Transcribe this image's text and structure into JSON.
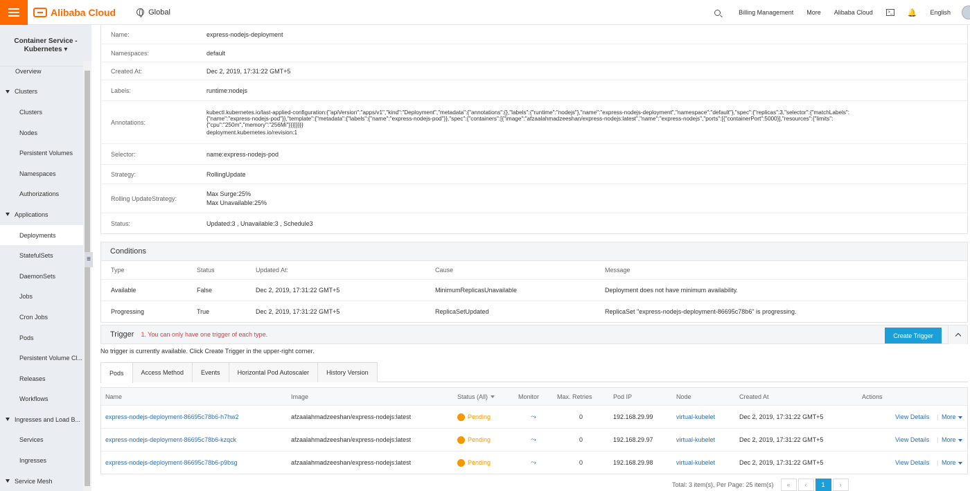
{
  "topbar": {
    "brand": "Alibaba Cloud",
    "region": "Global",
    "links": [
      "Billing Management",
      "More",
      "Alibaba Cloud"
    ],
    "language": "English"
  },
  "sidebar": {
    "title_line1": "Container Service -",
    "title_line2": "Kubernetes",
    "items": [
      {
        "label": "Overview",
        "kind": "top"
      },
      {
        "label": "Clusters",
        "kind": "group"
      },
      {
        "label": "Clusters",
        "kind": "child"
      },
      {
        "label": "Nodes",
        "kind": "child"
      },
      {
        "label": "Persistent Volumes",
        "kind": "child"
      },
      {
        "label": "Namespaces",
        "kind": "child"
      },
      {
        "label": "Authorizations",
        "kind": "child"
      },
      {
        "label": "Applications",
        "kind": "group"
      },
      {
        "label": "Deployments",
        "kind": "child",
        "active": true
      },
      {
        "label": "StatefulSets",
        "kind": "child"
      },
      {
        "label": "DaemonSets",
        "kind": "child"
      },
      {
        "label": "Jobs",
        "kind": "child"
      },
      {
        "label": "Cron Jobs",
        "kind": "child"
      },
      {
        "label": "Pods",
        "kind": "child"
      },
      {
        "label": "Persistent Volume Cl...",
        "kind": "child"
      },
      {
        "label": "Releases",
        "kind": "child"
      },
      {
        "label": "Workflows",
        "kind": "child"
      },
      {
        "label": "Ingresses and Load B...",
        "kind": "group"
      },
      {
        "label": "Services",
        "kind": "child"
      },
      {
        "label": "Ingresses",
        "kind": "child"
      },
      {
        "label": "Service Mesh",
        "kind": "group"
      }
    ]
  },
  "info": {
    "name_label": "Name:",
    "name": "express-nodejs-deployment",
    "namespace_label": "Namespaces:",
    "namespace": "default",
    "created_label": "Created At:",
    "created": "Dec 2, 2019, 17:31:22 GMT+5",
    "labels_label": "Labels:",
    "labels": "runtime:nodejs",
    "annotations_label": "Annotations:",
    "annotation_line1": "kubectl.kubernetes.io/last-applied-configuration:{\"apiVersion\":\"apps/v1\",\"kind\":\"Deployment\",\"metadata\":{\"annotations\":{},\"labels\":{\"runtime\":\"nodejs\"},\"name\":\"express-nodejs-deployment\",\"namespace\":\"default\"},\"spec\":{\"replicas\":3,\"selector\":{\"matchLabels\":",
    "annotation_line2": "{\"name\":\"express-nodejs-pod\"}},\"template\":{\"metadata\":{\"labels\":{\"name\":\"express-nodejs-pod\"}},\"spec\":{\"containers\":[{\"image\":\"afzaalahmadzeeshan/express-nodejs:latest\",\"name\":\"express-nodejs\",\"ports\":[{\"containerPort\":5000}],\"resources\":{\"limits\":",
    "annotation_line3": "{\"cpu\":\"250m\",\"memory\":\"256Mi\"}}}]}}}}",
    "annotation_line4": "deployment.kubernetes.io/revision:1",
    "selector_label": "Selector:",
    "selector": "name:express-nodejs-pod",
    "strategy_label": "Strategy:",
    "strategy": "RollingUpdate",
    "rolling_label": "Rolling UpdateStrategy:",
    "max_surge": "Max Surge:25%",
    "max_unavailable": "Max Unavailable:25%",
    "status_label": "Status:",
    "status": "Updated:3 ,  Unavailable:3 ,  Schedule3"
  },
  "conditions": {
    "title": "Conditions",
    "headers": [
      "Type",
      "Status",
      "Updated At:",
      "Cause",
      "Message"
    ],
    "rows": [
      [
        "Available",
        "False",
        "Dec 2, 2019, 17:31:22 GMT+5",
        "MinimumReplicasUnavailable",
        "Deployment does not have minimum availability."
      ],
      [
        "Progressing",
        "True",
        "Dec 2, 2019, 17:31:22 GMT+5",
        "ReplicaSetUpdated",
        "ReplicaSet \"express-nodejs-deployment-86695c78b6\" is progressing."
      ]
    ]
  },
  "trigger": {
    "title": "Trigger",
    "note": "1. You can only have one trigger of each type.",
    "create_label": "Create Trigger",
    "empty_text": "No trigger is currently available. Click Create Trigger in the upper-right corner."
  },
  "tabs": [
    "Pods",
    "Access Method",
    "Events",
    "Horizontal Pod Autoscaler",
    "History Version"
  ],
  "pods": {
    "headers": {
      "name": "Name",
      "image": "Image",
      "status": "Status (All)",
      "monitor": "Monitor",
      "retries": "Max. Retries",
      "ip": "Pod IP",
      "node": "Node",
      "created": "Created At",
      "actions": "Actions"
    },
    "rows": [
      {
        "name": "express-nodejs-deployment-86695c78b6-h7hw2",
        "image": "afzaalahmadzeeshan/express-nodejs:latest",
        "status": "Pending",
        "retries": "0",
        "ip": "192.168.29.99",
        "node": "virtual-kubelet",
        "created": "Dec 2, 2019, 17:31:22 GMT+5",
        "view": "View Details",
        "more": "More"
      },
      {
        "name": "express-nodejs-deployment-86695c78b6-kzqck",
        "image": "afzaalahmadzeeshan/express-nodejs:latest",
        "status": "Pending",
        "retries": "0",
        "ip": "192.168.29.97",
        "node": "virtual-kubelet",
        "created": "Dec 2, 2019, 17:31:22 GMT+5",
        "view": "View Details",
        "more": "More"
      },
      {
        "name": "express-nodejs-deployment-86695c78b6-p9bsg",
        "image": "afzaalahmadzeeshan/express-nodejs:latest",
        "status": "Pending",
        "retries": "0",
        "ip": "192.168.29.98",
        "node": "virtual-kubelet",
        "created": "Dec 2, 2019, 17:31:22 GMT+5",
        "view": "View Details",
        "more": "More"
      }
    ]
  },
  "pagination": {
    "summary": "Total: 3 item(s), Per Page: 25 item(s)",
    "first": "«",
    "prev": "‹",
    "current": "1",
    "next": "›"
  },
  "colors": {
    "brand": "#ff6a00",
    "primary": "#1c9ed9",
    "link": "#2a6fb8",
    "pending": "#f39800",
    "warning": "#e4393c"
  }
}
